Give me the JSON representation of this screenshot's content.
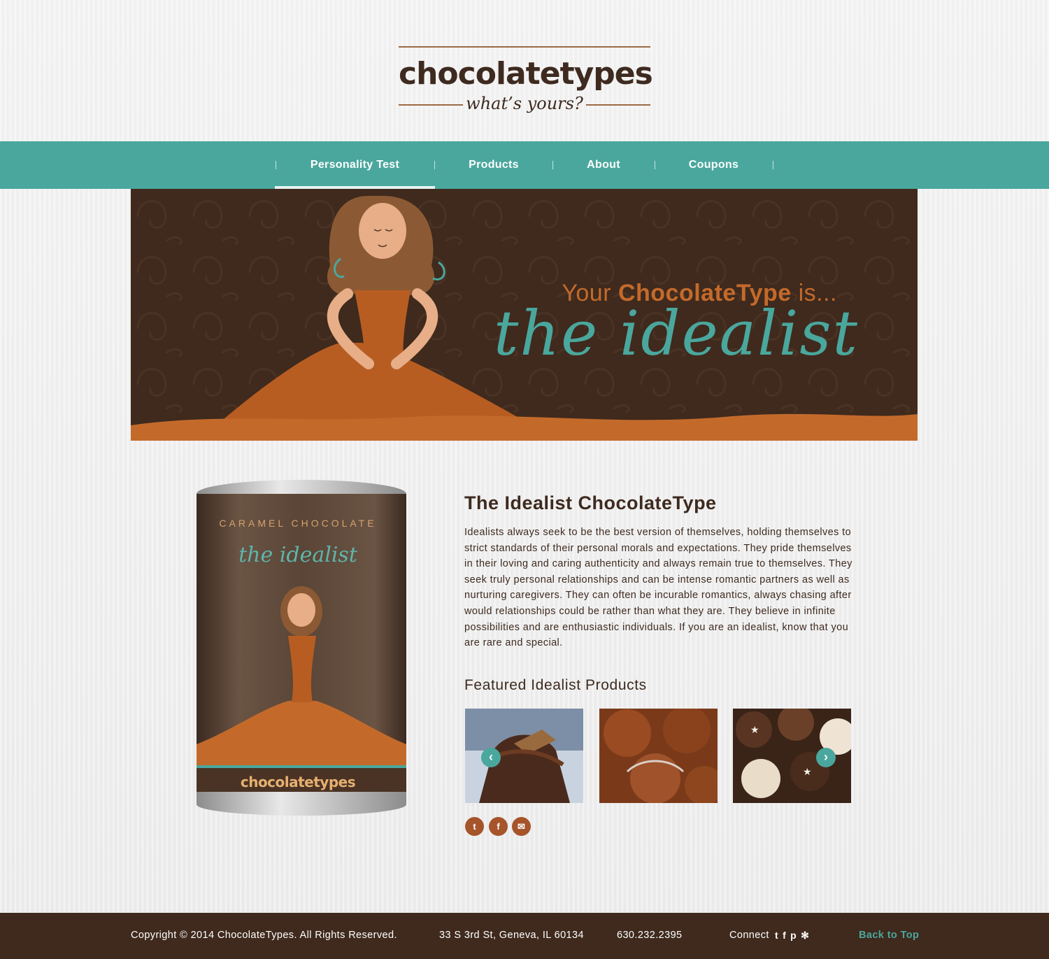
{
  "logo": {
    "name": "chocolatetypes",
    "tagline": "what’s yours?"
  },
  "nav": {
    "items": [
      "Personality Test",
      "Products",
      "About",
      "Coupons"
    ]
  },
  "banner": {
    "prefix": "Your ",
    "brand": "ChocolateType",
    "suffix": " is...",
    "type": "the idealist"
  },
  "can": {
    "flavor": "CARAMEL CHOCOLATE",
    "type": "the idealist",
    "brand": "chocolatetypes"
  },
  "content": {
    "title": "The Idealist ChocolateType",
    "description": "Idealists always seek to be the best version of themselves, holding themselves to strict standards of their personal morals and expectations. They pride themselves in their loving and caring authenticity and always remain true to themselves. They seek truly personal relationships and can be intense romantic partners as well as nurturing caregivers. They can often be incurable romantics, always chasing after would relationships could be rather than what they are. They believe in infinite possibilities and are enthusiastic individuals. If you are an idealist, know that you are rare and special.",
    "featured_heading": "Featured Idealist Products"
  },
  "carousel": {
    "prev_icon": "chevron-left-icon",
    "next_icon": "chevron-right-icon"
  },
  "share": [
    "twitter-icon",
    "facebook-icon",
    "email-icon"
  ],
  "footer": {
    "copyright": "Copyright © 2014 ChocolateTypes. All Rights Reserved.",
    "address": "33 S 3rd St, Geneva, IL 60134",
    "phone": "630.232.2395",
    "connect": "Connect",
    "connect_icons": [
      "twitter-icon",
      "facebook-icon",
      "pinterest-icon",
      "yelp-icon"
    ],
    "back_to_top": "Back to Top"
  },
  "colors": {
    "teal": "#4aa79d",
    "brown": "#3f2a1d",
    "orange": "#c36a2b"
  }
}
